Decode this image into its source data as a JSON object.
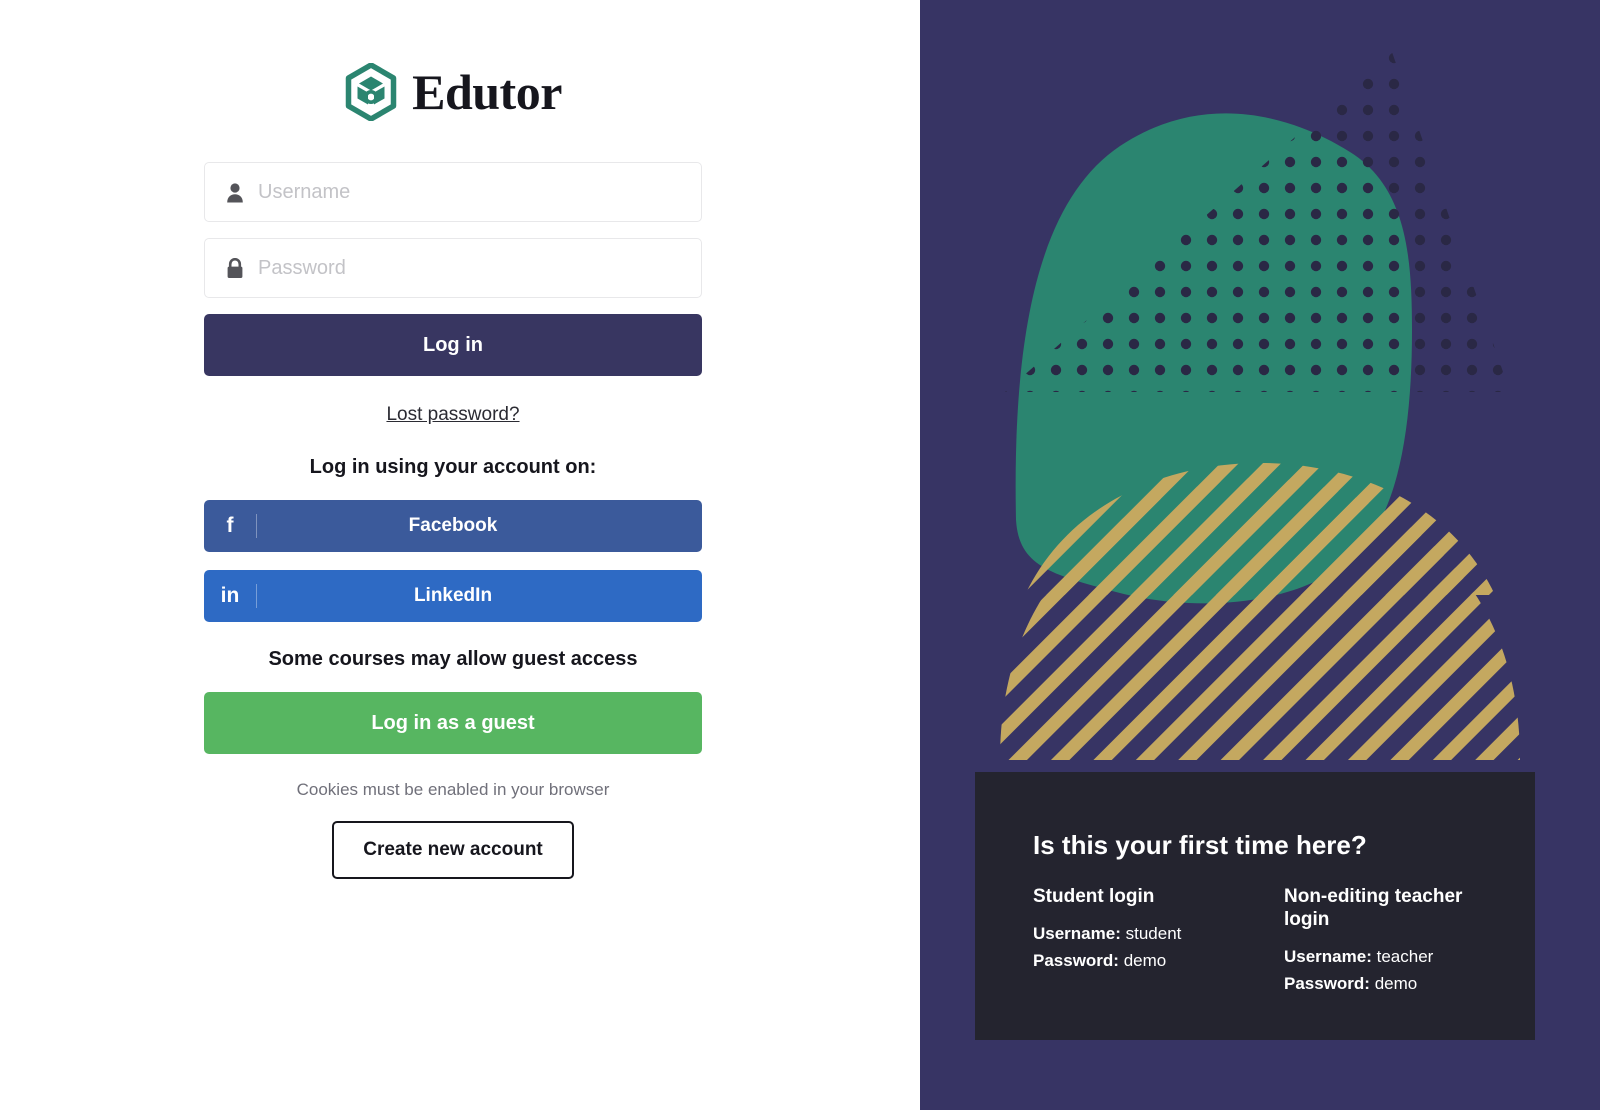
{
  "brand": {
    "name": "Edutor",
    "logo_icon": "hexagon-cube-logo-icon",
    "logo_color": "#2b8570"
  },
  "login_form": {
    "username": {
      "icon": "user-icon",
      "placeholder": "Username",
      "value": ""
    },
    "password": {
      "icon": "lock-icon",
      "placeholder": "Password",
      "value": ""
    },
    "login_button": "Log in",
    "login_button_color": "#383661",
    "lost_password_link": "Lost password?"
  },
  "social": {
    "heading": "Log in using your account on:",
    "providers": [
      {
        "label": "Facebook",
        "icon": "facebook-icon",
        "glyph": "f",
        "color": "#3b5a9b"
      },
      {
        "label": "LinkedIn",
        "icon": "linkedin-icon",
        "glyph": "in",
        "color": "#2e6ac4"
      }
    ]
  },
  "guest": {
    "heading": "Some courses may allow guest access",
    "button": "Log in as a guest",
    "button_color": "#57b661"
  },
  "footer": {
    "cookie_note": "Cookies must be enabled in your browser",
    "create_account_button": "Create new account"
  },
  "promo": {
    "background_color": "#373464",
    "blob_color": "#2b8570",
    "dot_color": "#2a2845",
    "stripe_color": "#c4a860",
    "card_background": "#24242f",
    "title": "Is this your first time here?",
    "columns": [
      {
        "title": "Student login",
        "username_label": "Username:",
        "username_value": "student",
        "password_label": "Password:",
        "password_value": "demo"
      },
      {
        "title": "Non-editing teacher login",
        "username_label": "Username:",
        "username_value": "teacher",
        "password_label": "Password:",
        "password_value": "demo"
      }
    ]
  }
}
